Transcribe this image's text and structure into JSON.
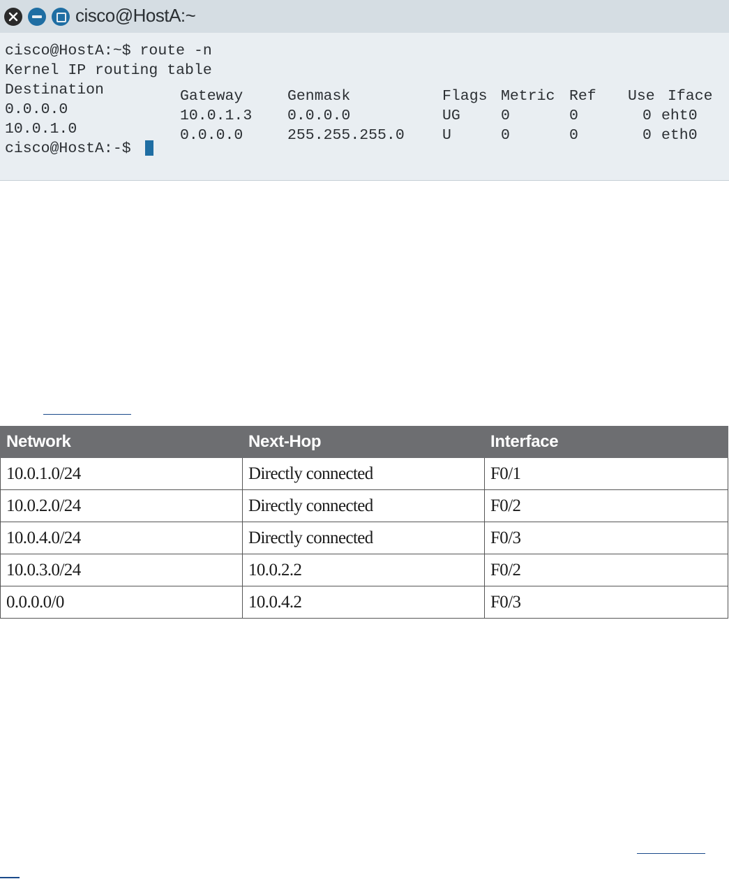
{
  "terminal": {
    "title": "cisco@HostA:~",
    "lines": {
      "command": "cisco@HostA:~$ route -n",
      "heading": "Kernel IP routing table",
      "dest_header": "Destination",
      "dest_row1": "0.0.0.0",
      "dest_row2": "10.0.1.0",
      "prompt": "cisco@HostA:-$ "
    },
    "columns": {
      "gateway": "Gateway",
      "genmask": "Genmask",
      "flags": "Flags",
      "metric": "Metric",
      "ref": "Ref",
      "use": "Use",
      "iface": "Iface"
    },
    "rows": [
      {
        "gateway": "10.0.1.3",
        "genmask": "0.0.0.0",
        "flags": "UG",
        "metric": "0",
        "ref": "0",
        "use": "0",
        "iface": "eht0"
      },
      {
        "gateway": "0.0.0.0",
        "genmask": "255.255.255.0",
        "flags": "U",
        "metric": "0",
        "ref": "0",
        "use": "0",
        "iface": "eth0"
      }
    ]
  },
  "routing_table": {
    "headers": [
      "Network",
      "Next-Hop",
      "Interface"
    ],
    "rows": [
      [
        "10.0.1.0/24",
        "Directly connected",
        "F0/1"
      ],
      [
        "10.0.2.0/24",
        "Directly connected",
        "F0/2"
      ],
      [
        "10.0.4.0/24",
        "Directly connected",
        "F0/3"
      ],
      [
        "10.0.3.0/24",
        "10.0.2.2",
        "F0/2"
      ],
      [
        "0.0.0.0/0",
        "10.0.4.2",
        "F0/3"
      ]
    ]
  }
}
